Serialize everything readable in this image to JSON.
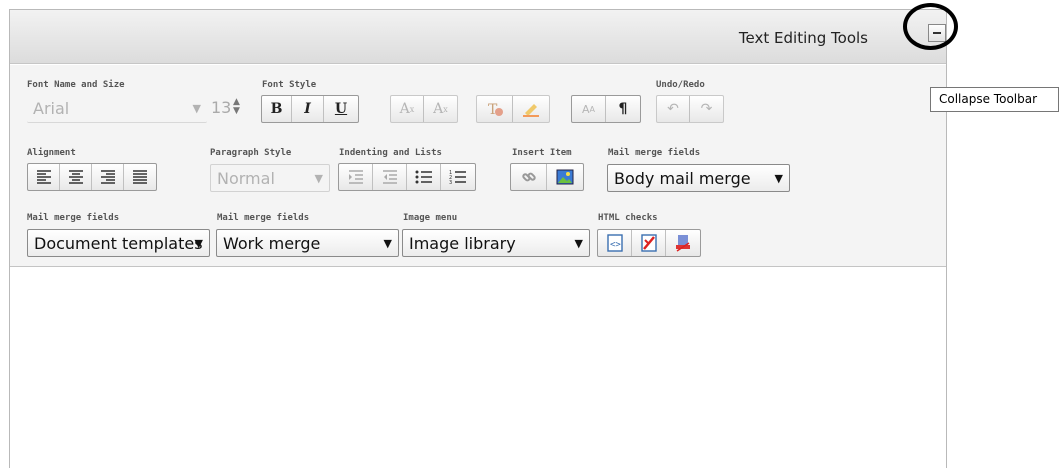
{
  "header": {
    "title": "Text Editing Tools"
  },
  "tooltip": {
    "text": "Collapse Toolbar"
  },
  "row1": {
    "font_label": "Font Name and Size",
    "font_name": "Arial",
    "font_size": "13",
    "style_label": "Font Style",
    "bold": "B",
    "italic": "I",
    "underline": "U",
    "subscript": "Ax",
    "superscript": "Ax",
    "undo_label": "Undo/Redo"
  },
  "row2": {
    "align_label": "Alignment",
    "para_label": "Paragraph Style",
    "para_value": "Normal",
    "indent_label": "Indenting and Lists",
    "insert_label": "Insert Item",
    "merge_label": "Mail merge fields",
    "merge_value": "Body mail merge"
  },
  "row3": {
    "merge1_label": "Mail merge fields",
    "merge1_value": "Document templates",
    "merge2_label": "Mail merge fields",
    "merge2_value": "Work merge",
    "image_label": "Image menu",
    "image_value": "Image library",
    "html_label": "HTML checks"
  },
  "icons": [
    "collapse-icon",
    "align-left-icon",
    "align-center-icon",
    "align-right-icon",
    "align-justify-icon",
    "indent-icon",
    "outdent-icon",
    "bullet-list-icon",
    "numbered-list-icon",
    "link-icon",
    "image-icon",
    "undo-icon",
    "redo-icon",
    "pilcrow-icon",
    "highlight-icon",
    "clear-format-icon"
  ]
}
